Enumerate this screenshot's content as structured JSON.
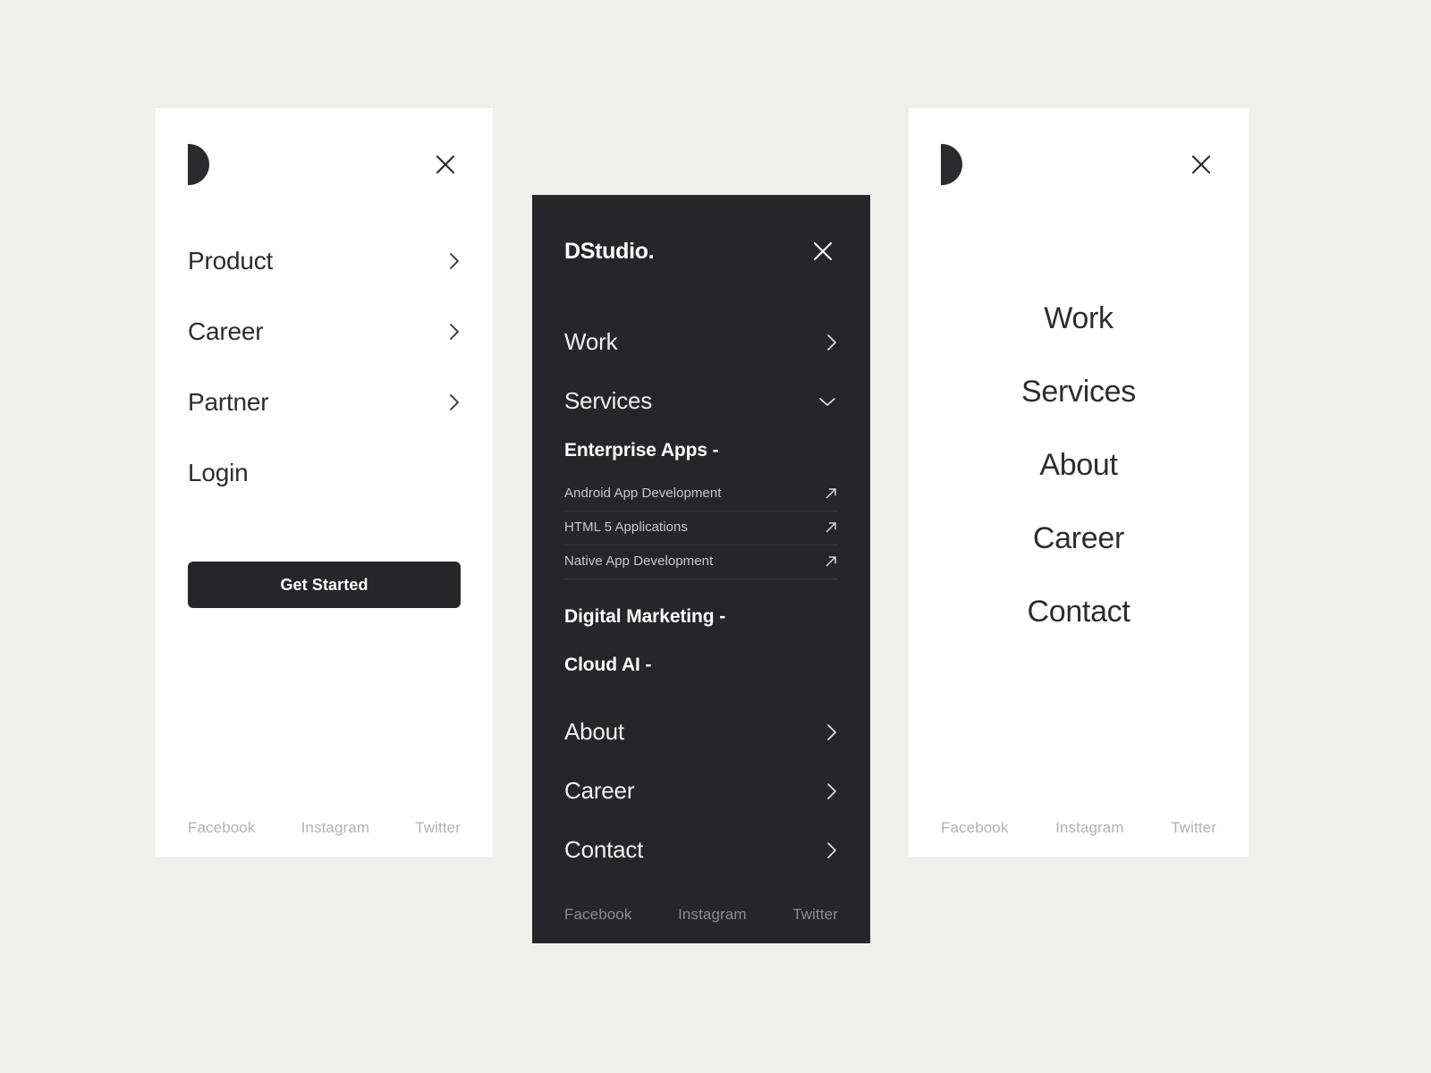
{
  "theme": {
    "background": "#efefee",
    "panel_light": "#ffffff",
    "panel_dark": "#262628",
    "text_dark": "#2d2d2f",
    "text_light": "#f1f1f1",
    "muted_light": "#b3b3b3",
    "muted_dark": "#8d8d90",
    "divider_dark": "#3b3b3d"
  },
  "panel_collapsed": {
    "logo_icon": "half-circle-d-logo",
    "close_icon": "close-x-icon",
    "nav": [
      {
        "label": "Product",
        "icon": "chevron-right-icon",
        "has_chevron": true
      },
      {
        "label": "Career",
        "icon": "chevron-right-icon",
        "has_chevron": true
      },
      {
        "label": "Partner",
        "icon": "chevron-right-icon",
        "has_chevron": true
      },
      {
        "label": "Login",
        "icon": "",
        "has_chevron": false
      }
    ],
    "cta_label": "Get Started",
    "footer": [
      {
        "label": "Facebook"
      },
      {
        "label": "Instagram"
      },
      {
        "label": "Twitter"
      }
    ]
  },
  "panel_expanded": {
    "wordmark": "DStudio.",
    "close_icon": "close-x-icon",
    "nav_top": [
      {
        "label": "Work",
        "icon": "chevron-right-icon",
        "expanded": false
      },
      {
        "label": "Services",
        "icon": "chevron-down-icon",
        "expanded": true
      }
    ],
    "services_groups": [
      {
        "heading": "Enterprise Apps -",
        "items": [
          {
            "label": "Android App Development",
            "icon": "arrow-up-right-icon"
          },
          {
            "label": "HTML 5 Applications",
            "icon": "arrow-up-right-icon"
          },
          {
            "label": "Native App Development",
            "icon": "arrow-up-right-icon"
          }
        ]
      },
      {
        "heading": "Digital Marketing -",
        "items": []
      },
      {
        "heading": "Cloud AI -",
        "items": []
      }
    ],
    "nav_bottom": [
      {
        "label": "About",
        "icon": "chevron-right-icon"
      },
      {
        "label": "Career",
        "icon": "chevron-right-icon"
      },
      {
        "label": "Contact",
        "icon": "chevron-right-icon"
      }
    ],
    "footer": [
      {
        "label": "Facebook"
      },
      {
        "label": "Instagram"
      },
      {
        "label": "Twitter"
      }
    ]
  },
  "panel_centered": {
    "logo_icon": "half-circle-d-logo",
    "close_icon": "close-x-icon",
    "nav": [
      {
        "label": "Work"
      },
      {
        "label": "Services"
      },
      {
        "label": "About"
      },
      {
        "label": "Career"
      },
      {
        "label": "Contact"
      }
    ],
    "footer": [
      {
        "label": "Facebook"
      },
      {
        "label": "Instagram"
      },
      {
        "label": "Twitter"
      }
    ]
  }
}
